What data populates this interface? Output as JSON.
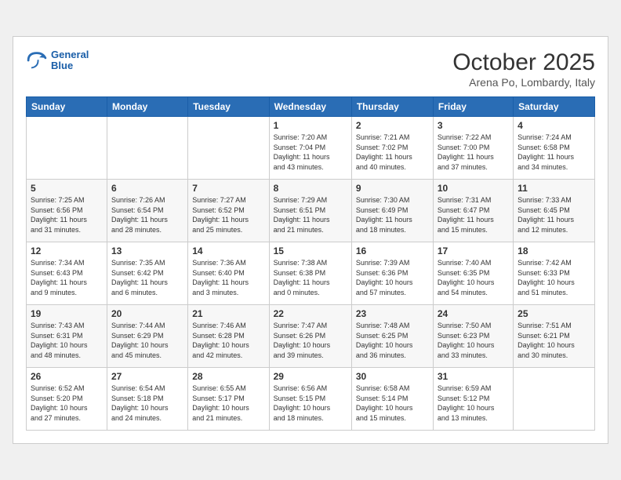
{
  "header": {
    "logo_line1": "General",
    "logo_line2": "Blue",
    "month": "October 2025",
    "location": "Arena Po, Lombardy, Italy"
  },
  "weekdays": [
    "Sunday",
    "Monday",
    "Tuesday",
    "Wednesday",
    "Thursday",
    "Friday",
    "Saturday"
  ],
  "weeks": [
    [
      {
        "day": "",
        "info": ""
      },
      {
        "day": "",
        "info": ""
      },
      {
        "day": "",
        "info": ""
      },
      {
        "day": "1",
        "info": "Sunrise: 7:20 AM\nSunset: 7:04 PM\nDaylight: 11 hours\nand 43 minutes."
      },
      {
        "day": "2",
        "info": "Sunrise: 7:21 AM\nSunset: 7:02 PM\nDaylight: 11 hours\nand 40 minutes."
      },
      {
        "day": "3",
        "info": "Sunrise: 7:22 AM\nSunset: 7:00 PM\nDaylight: 11 hours\nand 37 minutes."
      },
      {
        "day": "4",
        "info": "Sunrise: 7:24 AM\nSunset: 6:58 PM\nDaylight: 11 hours\nand 34 minutes."
      }
    ],
    [
      {
        "day": "5",
        "info": "Sunrise: 7:25 AM\nSunset: 6:56 PM\nDaylight: 11 hours\nand 31 minutes."
      },
      {
        "day": "6",
        "info": "Sunrise: 7:26 AM\nSunset: 6:54 PM\nDaylight: 11 hours\nand 28 minutes."
      },
      {
        "day": "7",
        "info": "Sunrise: 7:27 AM\nSunset: 6:52 PM\nDaylight: 11 hours\nand 25 minutes."
      },
      {
        "day": "8",
        "info": "Sunrise: 7:29 AM\nSunset: 6:51 PM\nDaylight: 11 hours\nand 21 minutes."
      },
      {
        "day": "9",
        "info": "Sunrise: 7:30 AM\nSunset: 6:49 PM\nDaylight: 11 hours\nand 18 minutes."
      },
      {
        "day": "10",
        "info": "Sunrise: 7:31 AM\nSunset: 6:47 PM\nDaylight: 11 hours\nand 15 minutes."
      },
      {
        "day": "11",
        "info": "Sunrise: 7:33 AM\nSunset: 6:45 PM\nDaylight: 11 hours\nand 12 minutes."
      }
    ],
    [
      {
        "day": "12",
        "info": "Sunrise: 7:34 AM\nSunset: 6:43 PM\nDaylight: 11 hours\nand 9 minutes."
      },
      {
        "day": "13",
        "info": "Sunrise: 7:35 AM\nSunset: 6:42 PM\nDaylight: 11 hours\nand 6 minutes."
      },
      {
        "day": "14",
        "info": "Sunrise: 7:36 AM\nSunset: 6:40 PM\nDaylight: 11 hours\nand 3 minutes."
      },
      {
        "day": "15",
        "info": "Sunrise: 7:38 AM\nSunset: 6:38 PM\nDaylight: 11 hours\nand 0 minutes."
      },
      {
        "day": "16",
        "info": "Sunrise: 7:39 AM\nSunset: 6:36 PM\nDaylight: 10 hours\nand 57 minutes."
      },
      {
        "day": "17",
        "info": "Sunrise: 7:40 AM\nSunset: 6:35 PM\nDaylight: 10 hours\nand 54 minutes."
      },
      {
        "day": "18",
        "info": "Sunrise: 7:42 AM\nSunset: 6:33 PM\nDaylight: 10 hours\nand 51 minutes."
      }
    ],
    [
      {
        "day": "19",
        "info": "Sunrise: 7:43 AM\nSunset: 6:31 PM\nDaylight: 10 hours\nand 48 minutes."
      },
      {
        "day": "20",
        "info": "Sunrise: 7:44 AM\nSunset: 6:29 PM\nDaylight: 10 hours\nand 45 minutes."
      },
      {
        "day": "21",
        "info": "Sunrise: 7:46 AM\nSunset: 6:28 PM\nDaylight: 10 hours\nand 42 minutes."
      },
      {
        "day": "22",
        "info": "Sunrise: 7:47 AM\nSunset: 6:26 PM\nDaylight: 10 hours\nand 39 minutes."
      },
      {
        "day": "23",
        "info": "Sunrise: 7:48 AM\nSunset: 6:25 PM\nDaylight: 10 hours\nand 36 minutes."
      },
      {
        "day": "24",
        "info": "Sunrise: 7:50 AM\nSunset: 6:23 PM\nDaylight: 10 hours\nand 33 minutes."
      },
      {
        "day": "25",
        "info": "Sunrise: 7:51 AM\nSunset: 6:21 PM\nDaylight: 10 hours\nand 30 minutes."
      }
    ],
    [
      {
        "day": "26",
        "info": "Sunrise: 6:52 AM\nSunset: 5:20 PM\nDaylight: 10 hours\nand 27 minutes."
      },
      {
        "day": "27",
        "info": "Sunrise: 6:54 AM\nSunset: 5:18 PM\nDaylight: 10 hours\nand 24 minutes."
      },
      {
        "day": "28",
        "info": "Sunrise: 6:55 AM\nSunset: 5:17 PM\nDaylight: 10 hours\nand 21 minutes."
      },
      {
        "day": "29",
        "info": "Sunrise: 6:56 AM\nSunset: 5:15 PM\nDaylight: 10 hours\nand 18 minutes."
      },
      {
        "day": "30",
        "info": "Sunrise: 6:58 AM\nSunset: 5:14 PM\nDaylight: 10 hours\nand 15 minutes."
      },
      {
        "day": "31",
        "info": "Sunrise: 6:59 AM\nSunset: 5:12 PM\nDaylight: 10 hours\nand 13 minutes."
      },
      {
        "day": "",
        "info": ""
      }
    ]
  ]
}
